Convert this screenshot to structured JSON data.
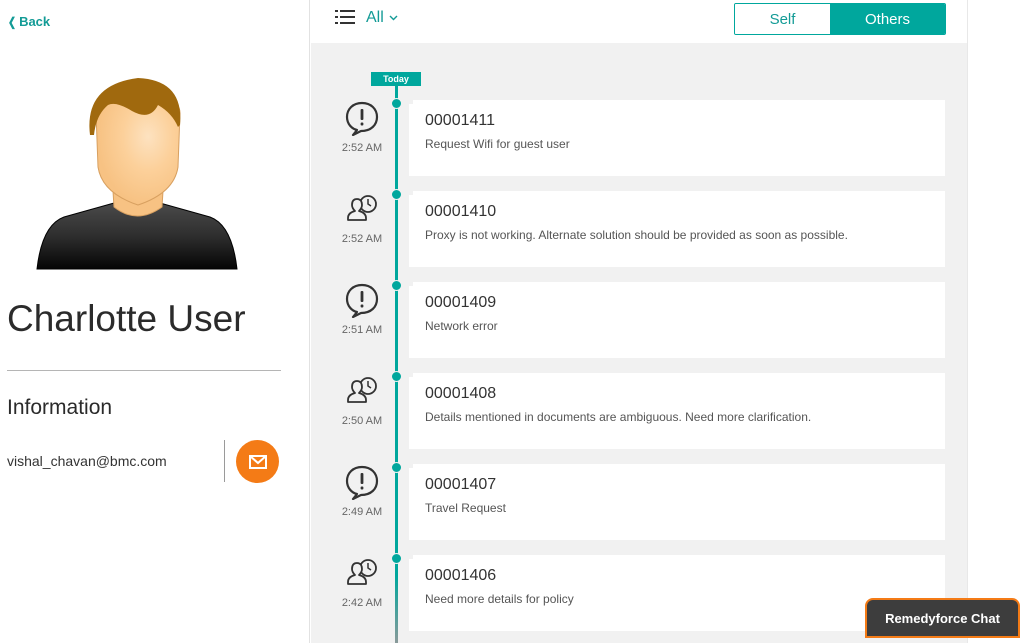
{
  "nav": {
    "back_label": "Back"
  },
  "profile": {
    "name": "Charlotte User",
    "info_title": "Information",
    "email": "vishal_chavan@bmc.com"
  },
  "header": {
    "filter_label": "All",
    "toggle": {
      "self_label": "Self",
      "others_label": "Others",
      "selected": "Others"
    }
  },
  "timeline": {
    "today_label": "Today",
    "items": [
      {
        "icon": "exclamation-bubble-icon",
        "time": "2:52 AM",
        "number": "00001411",
        "description": "Request Wifi for guest user"
      },
      {
        "icon": "user-clock-icon",
        "time": "2:52 AM",
        "number": "00001410",
        "description": "Proxy is not working. Alternate solution should be provided as soon as possible."
      },
      {
        "icon": "exclamation-bubble-icon",
        "time": "2:51 AM",
        "number": "00001409",
        "description": "Network error"
      },
      {
        "icon": "user-clock-icon",
        "time": "2:50 AM",
        "number": "00001408",
        "description": "Details mentioned in documents are ambiguous. Need more clarification."
      },
      {
        "icon": "exclamation-bubble-icon",
        "time": "2:49 AM",
        "number": "00001407",
        "description": "Travel Request"
      },
      {
        "icon": "user-clock-icon",
        "time": "2:42 AM",
        "number": "00001406",
        "description": "Need more details for policy"
      }
    ]
  },
  "chat": {
    "label": "Remedyforce Chat"
  },
  "colors": {
    "accent": "#00a79d",
    "email_button": "#f47b16",
    "chat_bg": "#3d3d3d"
  }
}
